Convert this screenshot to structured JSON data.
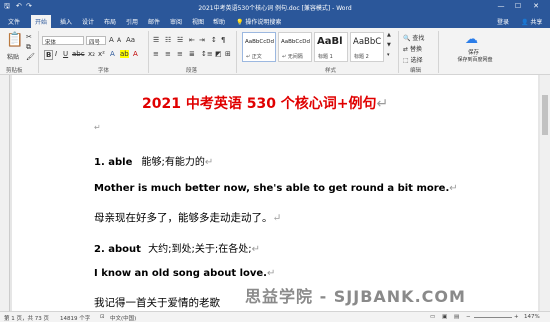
{
  "title_bar": {
    "title": "2021中考英语530个核心词 例句.doc [兼容模式] - Word",
    "undo": "↶",
    "redo": "↷",
    "minimize": "—",
    "maximize": "☐",
    "close": "✕"
  },
  "tabs": [
    "文件",
    "开始",
    "插入",
    "设计",
    "布局",
    "引用",
    "邮件",
    "审阅",
    "视图",
    "帮助"
  ],
  "tell_me": "操作说明搜索",
  "login": "登录",
  "share": "共享",
  "ribbon": {
    "paste_label": "粘贴",
    "clipboard_label": "剪贴板",
    "font_name": "宋体",
    "font_size": "四号",
    "font_label": "字体",
    "paragraph_label": "段落",
    "styles_label": "样式",
    "editing_label": "编辑",
    "save_label": "保存",
    "save_sub": "保存到百度网盘",
    "find": "查找",
    "replace": "替换",
    "select": "选择",
    "styles": [
      {
        "preview": "AaBbCcDd",
        "name": "↵ 正文"
      },
      {
        "preview": "AaBbCcDd",
        "name": "↵ 无间隔"
      },
      {
        "preview": "AaBl",
        "name": "标题 1"
      },
      {
        "preview": "AaBbC",
        "name": "标题 2"
      }
    ]
  },
  "document": {
    "heading": "2021 中考英语 530 个核心词+例句",
    "word1_num": "1. able",
    "word1_meaning": "能够;有能力的",
    "example1_en": "Mother is much better now, she's able to get round a bit more.",
    "example1_cn": "母亲现在好多了，能够多走动走动了。",
    "word2_num": "2. about",
    "word2_meaning": "大约;到处;关于;在各处;",
    "example2_en": "I know an old song about love.",
    "example2_cn_partial": "我记得一首关于爱情的老歌"
  },
  "status": {
    "page": "第 1 页，共 73 页",
    "words": "14819 个字",
    "language": "中文(中国)",
    "zoom": "147%"
  },
  "watermark": "思益学院 - SJJBANK.COM"
}
